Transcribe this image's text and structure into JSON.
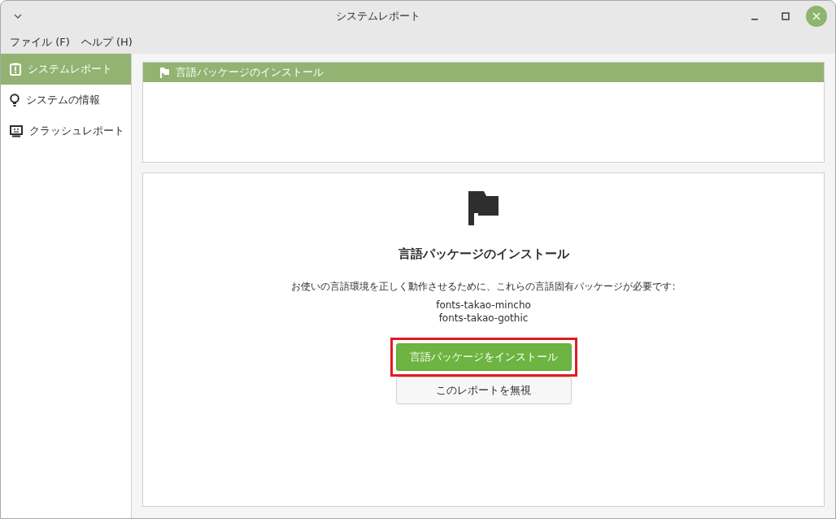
{
  "window": {
    "title": "システムレポート"
  },
  "menu": [
    "ファイル (F)",
    "ヘルプ (H)"
  ],
  "sidebar": {
    "items": [
      {
        "label": "システムレポート",
        "kind": "clipboard",
        "selected": true
      },
      {
        "label": "システムの情報",
        "kind": "bulb",
        "selected": false
      },
      {
        "label": "クラッシュレポート",
        "kind": "monitor",
        "selected": false
      }
    ]
  },
  "reports": [
    {
      "label": "言語パッケージのインストール",
      "selected": true
    }
  ],
  "detail": {
    "title": "言語パッケージのインストール",
    "message": "お使いの言語環境を正しく動作させるために、これらの言語固有パッケージが必要です:",
    "packages": [
      "fonts-takao-mincho",
      "fonts-takao-gothic"
    ],
    "buttons": [
      {
        "label": "言語パッケージをインストール",
        "kind": "primary",
        "highlighted": true
      },
      {
        "label": "このレポートを無視",
        "kind": "secondary",
        "highlighted": false
      }
    ]
  }
}
